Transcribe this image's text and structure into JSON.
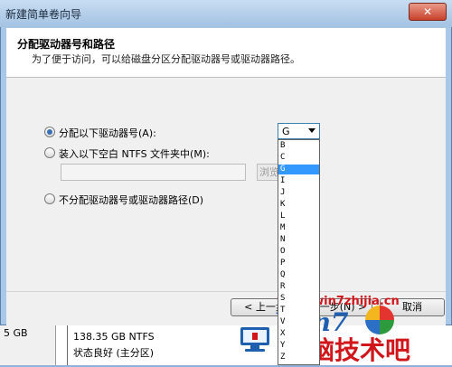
{
  "window": {
    "title": "新建简单卷向导",
    "close_glyph": "✕"
  },
  "header": {
    "title": "分配驱动器号和路径",
    "subtitle": "为了便于访问，可以给磁盘分区分配驱动器号或驱动器路径。"
  },
  "options": {
    "assign_letter": "分配以下驱动器号(A):",
    "mount_folder": "装入以下空白 NTFS 文件夹中(M):",
    "no_assign": "不分配驱动器号或驱动器路径(D)",
    "selected": "assign_letter"
  },
  "path_field": {
    "value": ""
  },
  "browse_button": "浏览(",
  "drive_select": {
    "value": "G",
    "options": [
      "B",
      "C",
      "G",
      "I",
      "J",
      "K",
      "L",
      "M",
      "N",
      "O",
      "P",
      "Q",
      "R",
      "S",
      "T",
      "V",
      "X",
      "Y",
      "Z"
    ],
    "highlighted": "G"
  },
  "buttons": {
    "back": "< 上一步",
    "next": "下一步(N) >",
    "cancel": "取消"
  },
  "disk_info": {
    "left_size": "5 GB",
    "partition_size": "138.35 GB NTFS",
    "partition_status": "状态良好 (主分区)"
  },
  "watermark": {
    "url": "www.win7zhijia.cn",
    "brand": "Win7",
    "site_name": "电脑技术吧"
  },
  "colors": {
    "accent": "#3399ff",
    "title_bar": "#a9c8e8",
    "watermark_red": "#d0161b"
  }
}
